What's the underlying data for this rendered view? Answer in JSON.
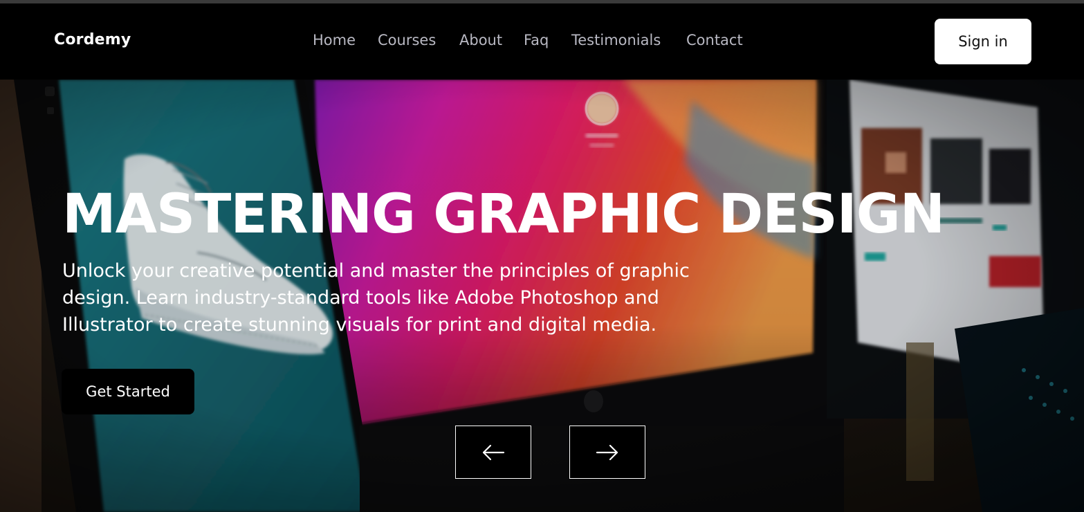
{
  "brand": "Cordemy",
  "nav": {
    "links": [
      "Home",
      "Courses",
      "About",
      "Faq",
      "Testimonials",
      "Contact"
    ],
    "signin_label": "Sign in"
  },
  "hero": {
    "title": "MASTERING GRAPHIC DESIGN",
    "description": "Unlock your creative potential and master the principles of graphic design. Learn industry-standard tools like Adobe Photoshop and Illustrator to create stunning visuals for print and digital media.",
    "cta_label": "Get Started",
    "prev_icon": "arrow-left-icon",
    "next_icon": "arrow-right-icon"
  },
  "colors": {
    "navbar_bg": "#000000",
    "nav_link": "#b9b9c3",
    "button_light": "#ffffff",
    "button_dark": "#000000"
  }
}
